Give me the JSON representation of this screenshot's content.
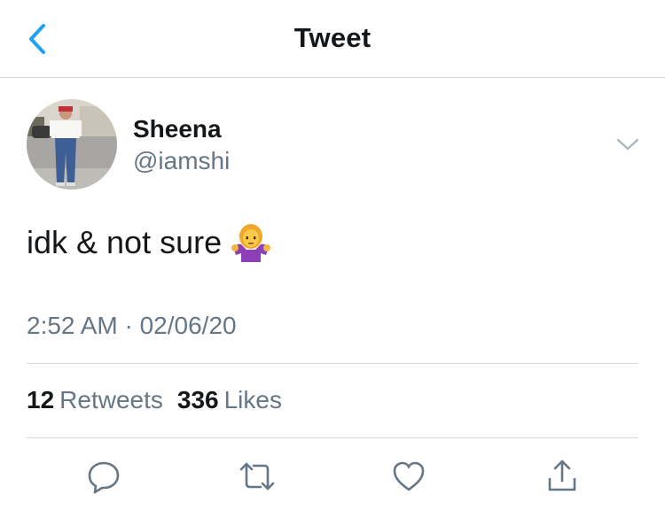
{
  "header": {
    "title": "Tweet",
    "back_icon": "chevron-left-icon",
    "accent_color": "#1da1f2"
  },
  "tweet": {
    "author_name": "Sheena",
    "author_handle": "@iamshi",
    "text": "idk & not sure",
    "emoji": "person-shrugging-emoji",
    "timestamp": "2:52 AM · 02/06/20",
    "retweet_count": "12",
    "retweet_label": "Retweets",
    "like_count": "336",
    "like_label": "Likes"
  },
  "actions": [
    {
      "icon": "reply-icon"
    },
    {
      "icon": "retweet-icon"
    },
    {
      "icon": "heart-icon"
    },
    {
      "icon": "share-icon"
    }
  ],
  "colors": {
    "text_primary": "#14171a",
    "text_secondary": "#657786",
    "divider": "#d6d9db"
  }
}
